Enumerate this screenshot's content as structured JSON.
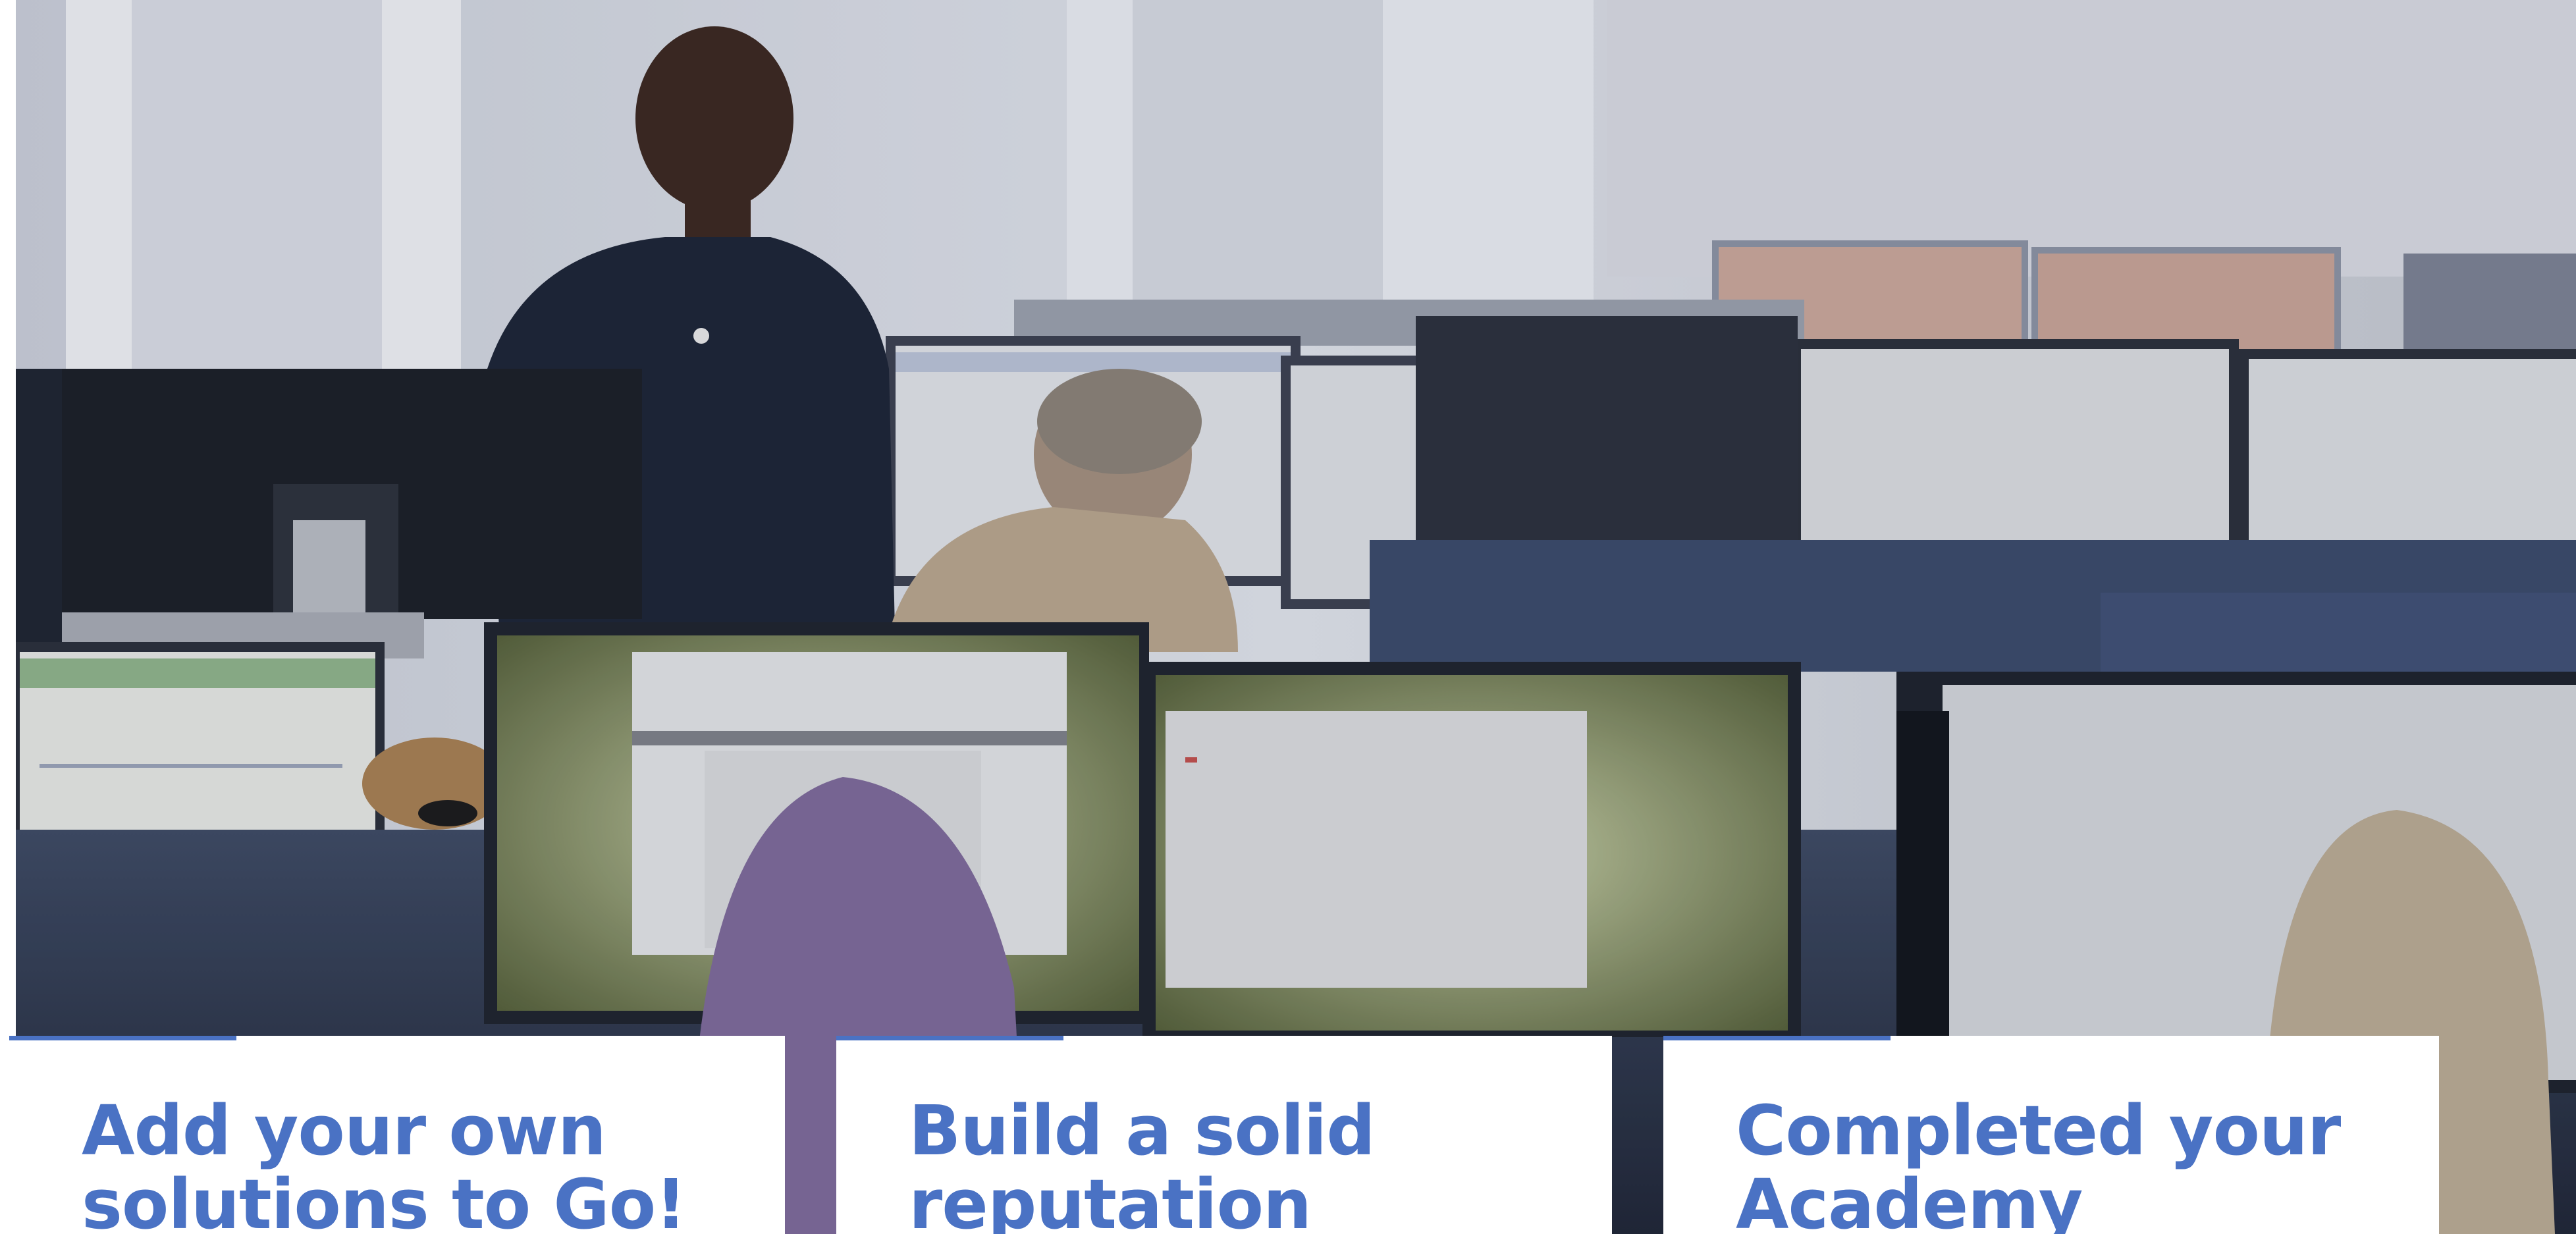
{
  "hero": {
    "image_label": "office-team-photo"
  },
  "cards": [
    {
      "title": "Add your own solutions to Go!"
    },
    {
      "title": "Build a solid reputation"
    },
    {
      "title": "Completed your Academy"
    }
  ],
  "colors": {
    "accent": "#4a72c4",
    "card_background": "#ffffff"
  }
}
